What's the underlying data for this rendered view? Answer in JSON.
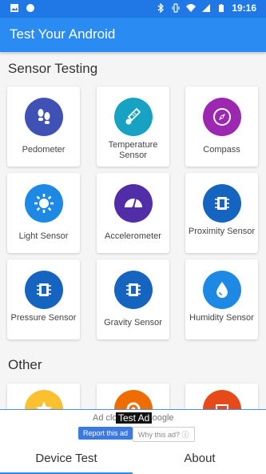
{
  "status_bar": {
    "time": "19:16"
  },
  "app_bar": {
    "title": "Test Your Android"
  },
  "sections": {
    "sensor_title": "Sensor Testing",
    "other_title": "Other"
  },
  "sensors": [
    {
      "label": "Pedometer",
      "icon": "footprints-icon",
      "color": "#3f51b5"
    },
    {
      "label": "Temperature Sensor",
      "icon": "thermometer-icon",
      "color": "#17a2c4"
    },
    {
      "label": "Compass",
      "icon": "compass-icon",
      "color": "#9c27b0"
    },
    {
      "label": "Light Sensor",
      "icon": "sun-icon",
      "color": "#1e88e5"
    },
    {
      "label": "Accelerometer",
      "icon": "gauge-icon",
      "color": "#512da8"
    },
    {
      "label": "Proximity Sensor",
      "icon": "chip-icon",
      "color": "#1565c0"
    },
    {
      "label": "Pressure Sensor",
      "icon": "chip-icon",
      "color": "#1565c0"
    },
    {
      "label": "Gravity Sensor",
      "icon": "chip-icon",
      "color": "#1565c0"
    },
    {
      "label": "Humidity Sensor",
      "icon": "drop-icon",
      "color": "#1e88e5"
    }
  ],
  "other": [
    {
      "icon": "star-icon",
      "color": "#fbc02d"
    },
    {
      "icon": "gear-icon",
      "color": "#ef6c00"
    },
    {
      "icon": "screen-icon",
      "color": "#e64a19"
    }
  ],
  "ad": {
    "closed_text": "Ad closed by Google",
    "test_label": "Test Ad",
    "report_label": "Report this ad",
    "why_label": "Why this ad? ⓘ"
  },
  "bottom_nav": {
    "device_test": "Device Test",
    "about": "About"
  }
}
